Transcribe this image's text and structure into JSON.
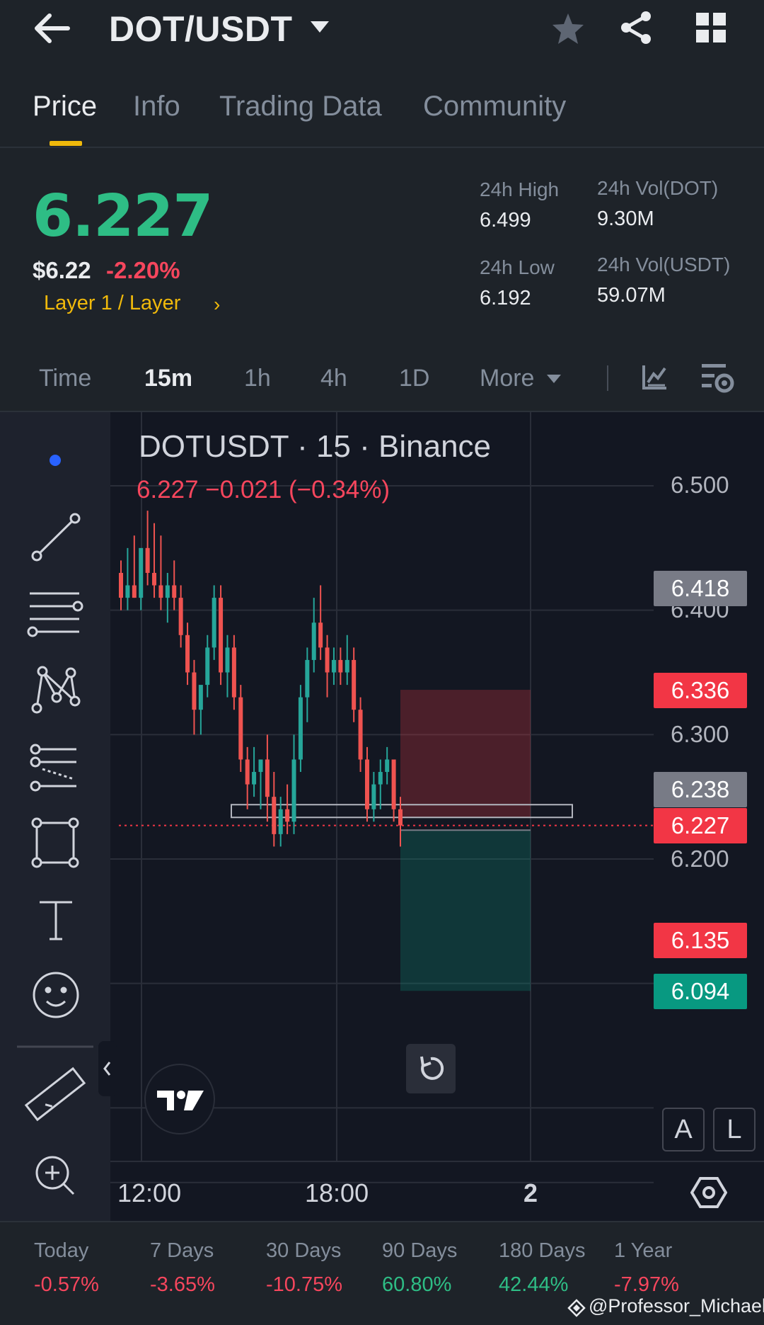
{
  "header": {
    "pair": "DOT/USDT",
    "icons": [
      "back-arrow-icon",
      "caret-down-icon",
      "star-icon",
      "share-icon",
      "grid-icon"
    ]
  },
  "tabs": [
    {
      "label": "Price",
      "active": true
    },
    {
      "label": "Info",
      "active": false
    },
    {
      "label": "Trading Data",
      "active": false
    },
    {
      "label": "Community",
      "active": false
    }
  ],
  "ticker": {
    "last_price": "6.227",
    "usd_price": "$6.22",
    "change_pct": "-2.20%",
    "category": "Layer 1 / Layer",
    "category_arrow": "›",
    "high_label": "24h High",
    "high_value": "6.499",
    "low_label": "24h Low",
    "low_value": "6.192",
    "vol_dot_label": "24h Vol(DOT)",
    "vol_dot_value": "9.30M",
    "vol_usdt_label": "24h Vol(USDT)",
    "vol_usdt_value": "59.07M"
  },
  "intervals": {
    "time": "Time",
    "i15m": "15m",
    "i1h": "1h",
    "i4h": "4h",
    "i1d": "1D",
    "more": "More",
    "selected": "15m"
  },
  "chart": {
    "symbol_line": "DOTUSDT · 15 · Binance",
    "ohlc_line": "6.227  −0.021 (−0.34%)",
    "axis_labels": [
      "6.500",
      "6.400",
      "6.300",
      "6.200"
    ],
    "price_tags": [
      {
        "value": "6.418",
        "color": "#787b86"
      },
      {
        "value": "6.336",
        "color": "#f23645"
      },
      {
        "value": "6.238",
        "color": "#787b86"
      },
      {
        "value": "6.227",
        "color": "#f23645"
      },
      {
        "value": "6.135",
        "color": "#f23645"
      },
      {
        "value": "6.094",
        "color": "#089981"
      }
    ],
    "time_labels": [
      "12:00",
      "18:00",
      "2"
    ],
    "auto_label": "A",
    "log_label": "L",
    "colors": {
      "up": "#26a69a",
      "down": "#ef5350",
      "bg": "#131722"
    }
  },
  "chart_data": {
    "type": "candlestick",
    "symbol": "DOTUSDT",
    "interval": "15",
    "exchange": "Binance",
    "ylim": [
      6.05,
      6.52
    ],
    "last": 6.227,
    "candles": [
      [
        6.43,
        6.44,
        6.4,
        6.41
      ],
      [
        6.41,
        6.45,
        6.4,
        6.42
      ],
      [
        6.42,
        6.46,
        6.41,
        6.41
      ],
      [
        6.41,
        6.44,
        6.4,
        6.45
      ],
      [
        6.45,
        6.48,
        6.42,
        6.43
      ],
      [
        6.43,
        6.47,
        6.41,
        6.42
      ],
      [
        6.42,
        6.46,
        6.4,
        6.41
      ],
      [
        6.41,
        6.43,
        6.39,
        6.42
      ],
      [
        6.42,
        6.44,
        6.4,
        6.41
      ],
      [
        6.41,
        6.42,
        6.37,
        6.38
      ],
      [
        6.38,
        6.39,
        6.34,
        6.35
      ],
      [
        6.35,
        6.36,
        6.3,
        6.32
      ],
      [
        6.32,
        6.33,
        6.3,
        6.34
      ],
      [
        6.34,
        6.38,
        6.33,
        6.37
      ],
      [
        6.37,
        6.42,
        6.36,
        6.41
      ],
      [
        6.41,
        6.42,
        6.34,
        6.35
      ],
      [
        6.35,
        6.38,
        6.33,
        6.37
      ],
      [
        6.37,
        6.38,
        6.32,
        6.33
      ],
      [
        6.33,
        6.34,
        6.27,
        6.28
      ],
      [
        6.28,
        6.29,
        6.24,
        6.26
      ],
      [
        6.26,
        6.29,
        6.25,
        6.27
      ],
      [
        6.27,
        6.28,
        6.24,
        6.28
      ],
      [
        6.28,
        6.3,
        6.23,
        6.25
      ],
      [
        6.25,
        6.27,
        6.21,
        6.22
      ],
      [
        6.22,
        6.25,
        6.21,
        6.24
      ],
      [
        6.24,
        6.26,
        6.22,
        6.23
      ],
      [
        6.23,
        6.3,
        6.22,
        6.28
      ],
      [
        6.28,
        6.34,
        6.27,
        6.33
      ],
      [
        6.33,
        6.37,
        6.31,
        6.36
      ],
      [
        6.36,
        6.41,
        6.35,
        6.39
      ],
      [
        6.39,
        6.42,
        6.36,
        6.37
      ],
      [
        6.37,
        6.38,
        6.33,
        6.35
      ],
      [
        6.35,
        6.37,
        6.34,
        6.36
      ],
      [
        6.36,
        6.37,
        6.34,
        6.35
      ],
      [
        6.35,
        6.38,
        6.34,
        6.36
      ],
      [
        6.36,
        6.37,
        6.31,
        6.32
      ],
      [
        6.32,
        6.33,
        6.27,
        6.28
      ],
      [
        6.28,
        6.29,
        6.23,
        6.24
      ],
      [
        6.24,
        6.27,
        6.23,
        6.26
      ],
      [
        6.26,
        6.28,
        6.24,
        6.27
      ],
      [
        6.27,
        6.29,
        6.26,
        6.28
      ],
      [
        6.28,
        6.28,
        6.23,
        6.24
      ],
      [
        6.24,
        6.25,
        6.21,
        6.227
      ]
    ],
    "annotations": {
      "stop_zone_top": 6.336,
      "entry": 6.238,
      "target": 6.094,
      "rect_level": 6.238
    }
  },
  "toolbar": {
    "tools": [
      "trend-line-icon",
      "fib-retracement-icon",
      "pattern-icon",
      "prediction-icon",
      "rectangle-icon",
      "text-icon",
      "emoji-icon",
      "ruler-icon",
      "zoom-in-icon"
    ]
  },
  "performance": [
    {
      "label": "Today",
      "value": "-0.57%",
      "positive": false
    },
    {
      "label": "7 Days",
      "value": "-3.65%",
      "positive": false
    },
    {
      "label": "30 Days",
      "value": "-10.75%",
      "positive": false
    },
    {
      "label": "90 Days",
      "value": "60.80%",
      "positive": true
    },
    {
      "label": "180 Days",
      "value": "42.44%",
      "positive": true
    },
    {
      "label": "1 Year",
      "value": "-7.97%",
      "positive": false
    }
  ],
  "watermark": "@Professor_Michael"
}
